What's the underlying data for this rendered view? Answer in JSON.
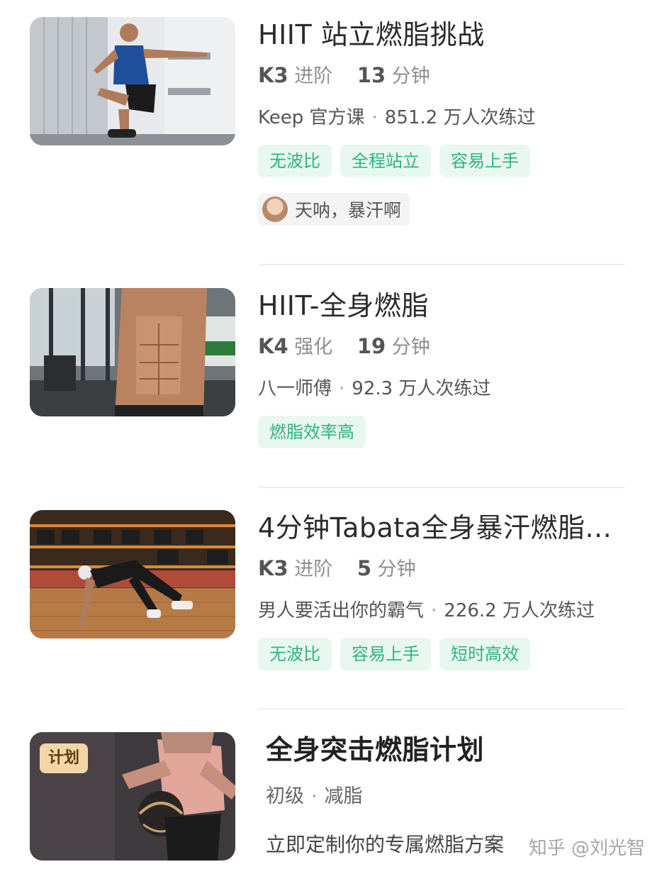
{
  "courses": [
    {
      "title": "HIIT 站立燃脂挑战",
      "level_code": "K3",
      "level_name": "进阶",
      "minutes": "13",
      "minutes_unit": "分钟",
      "author": "Keep 官方课",
      "plays": "851.2 万人次练过",
      "tags": [
        "无波比",
        "全程站立",
        "容易上手"
      ],
      "comment": "天呐，暴汗啊"
    },
    {
      "title": "HIIT-全身燃脂",
      "level_code": "K4",
      "level_name": "强化",
      "minutes": "19",
      "minutes_unit": "分钟",
      "author": "八一师傅",
      "plays": "92.3 万人次练过",
      "tags": [
        "燃脂效率高"
      ]
    },
    {
      "title": "4分钟Tabata全身暴汗燃脂...",
      "level_code": "K3",
      "level_name": "进阶",
      "minutes": "5",
      "minutes_unit": "分钟",
      "author": "男人要活出你的霸气",
      "plays": "226.2 万人次练过",
      "tags": [
        "无波比",
        "容易上手",
        "短时高效"
      ]
    }
  ],
  "plan": {
    "badge": "计划",
    "title": "全身突击燃脂计划",
    "level": "初级",
    "goal": "减脂",
    "description": "立即定制你的专属燃脂方案"
  },
  "watermark": "知乎 @刘光智",
  "colors": {
    "tag_bg": "#e8f8f1",
    "tag_text": "#2fb47c",
    "plan_badge_bg": "#f2d6a6"
  }
}
